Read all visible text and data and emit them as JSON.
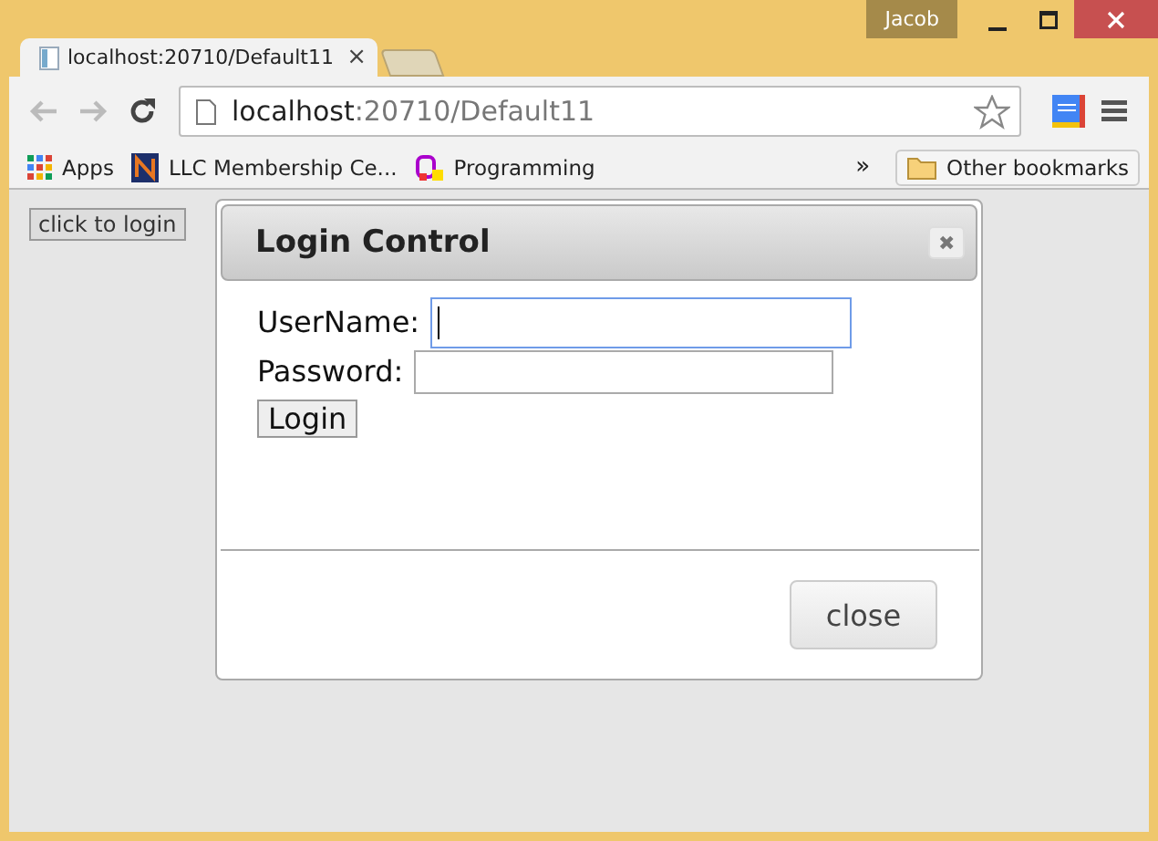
{
  "window": {
    "user": "Jacob"
  },
  "tabs": [
    {
      "title": "localhost:20710/Default11",
      "close": "×"
    }
  ],
  "address": {
    "host": "localhost",
    "path": ":20710/Default11"
  },
  "bookmarks": [
    {
      "label": "Apps",
      "kind": "apps"
    },
    {
      "label": "LLC Membership Ce...",
      "kind": "n"
    },
    {
      "label": "Programming",
      "kind": "prog"
    }
  ],
  "bookmarks_more": "»",
  "other_bookmarks": "Other bookmarks",
  "page": {
    "open_button": "click to login"
  },
  "dialog": {
    "title": "Login Control",
    "close_glyph": "✖",
    "fields": [
      {
        "label": "UserName:",
        "focused": true
      },
      {
        "label": "Password:",
        "focused": false
      }
    ],
    "login_button": "Login",
    "close_button": "close"
  }
}
